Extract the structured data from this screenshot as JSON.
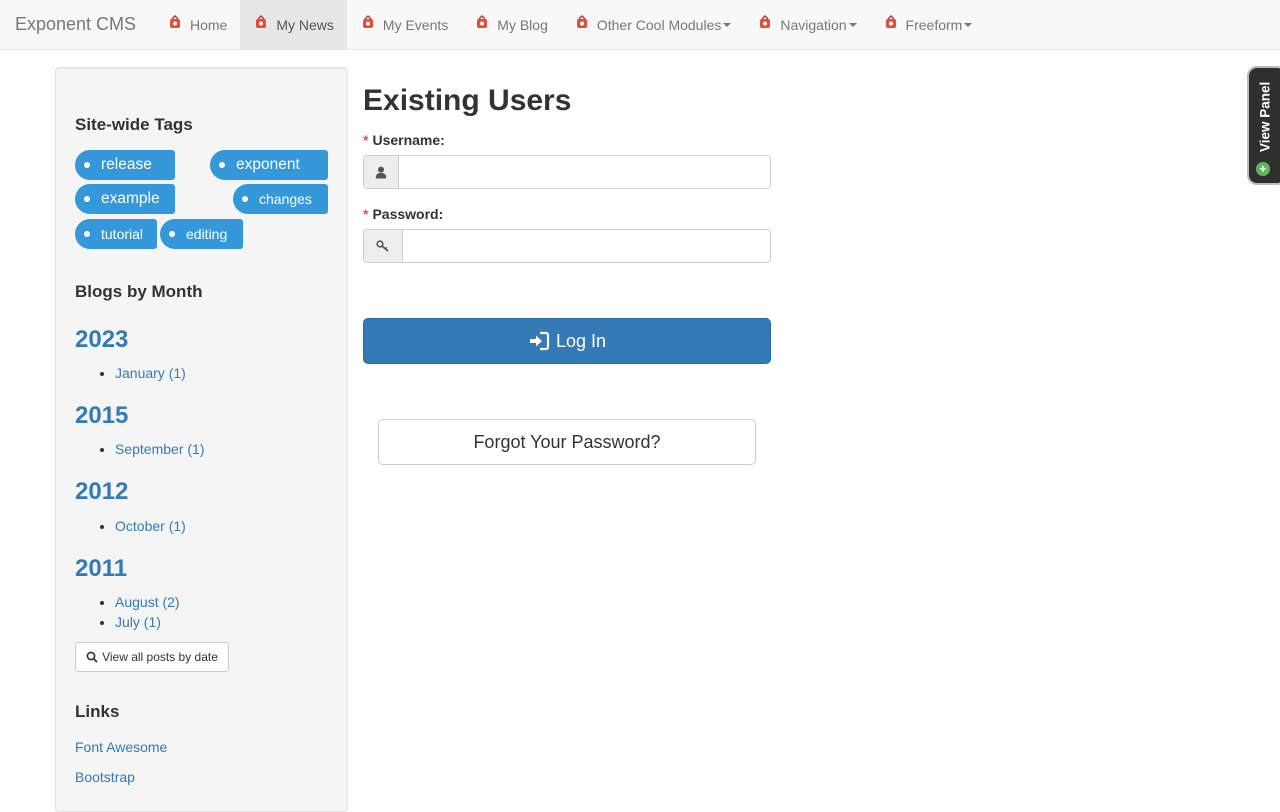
{
  "navbar": {
    "brand": "Exponent CMS",
    "items": [
      {
        "label": "Home"
      },
      {
        "label": "My News"
      },
      {
        "label": "My Events"
      },
      {
        "label": "My Blog"
      },
      {
        "label": "Other Cool Modules"
      },
      {
        "label": "Navigation"
      },
      {
        "label": "Freeform"
      }
    ]
  },
  "sidebar": {
    "tags_heading": "Site-wide Tags",
    "tags": [
      "release",
      "exponent",
      "example",
      "changes",
      "tutorial",
      "editing"
    ],
    "blogs_heading": "Blogs by Month",
    "years": [
      {
        "year": "2023",
        "months": [
          "January (1)"
        ]
      },
      {
        "year": "2015",
        "months": [
          "September (1)"
        ]
      },
      {
        "year": "2012",
        "months": [
          "October (1)"
        ]
      },
      {
        "year": "2011",
        "months": [
          "August (2)",
          "July (1)"
        ]
      }
    ],
    "view_all_label": "View all posts by date",
    "links_heading": "Links",
    "links": [
      "Font Awesome",
      "Bootstrap"
    ]
  },
  "login": {
    "title": "Existing Users",
    "required_marker": "*",
    "username_label": "Username:",
    "username_value": "",
    "password_label": "Password:",
    "password_value": "",
    "login_button": "Log In",
    "forgot_button": "Forgot Your Password?"
  },
  "view_panel": {
    "label": "View Panel",
    "plus": "+"
  },
  "colors": {
    "accent": "#337ab7",
    "tag": "#3498db",
    "required": "#d9534f",
    "panel_plus": "#5cb85c"
  }
}
